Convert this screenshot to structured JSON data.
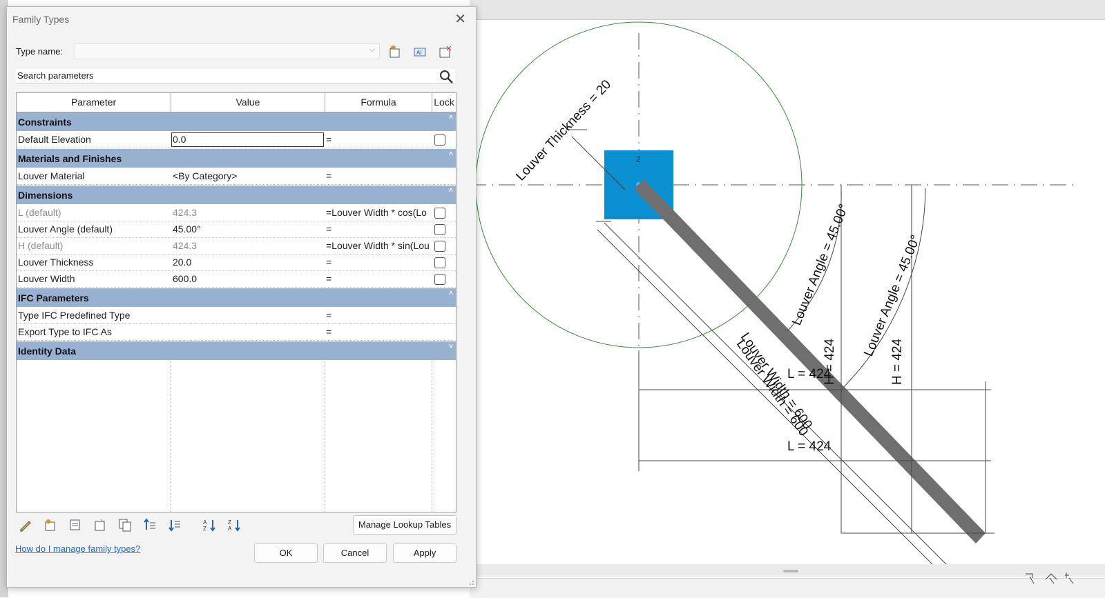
{
  "dialog": {
    "title": "Family Types",
    "type_name_label": "Type name:",
    "type_name_value": "",
    "search_placeholder": "Search parameters",
    "columns": {
      "parameter": "Parameter",
      "value": "Value",
      "formula": "Formula",
      "lock": "Lock"
    },
    "groups": {
      "constraints": "Constraints",
      "materials": "Materials and Finishes",
      "dimensions": "Dimensions",
      "ifc": "IFC Parameters",
      "identity": "Identity Data"
    },
    "rows": {
      "default_elevation": {
        "name": "Default Elevation",
        "value": "0.0",
        "formula": "="
      },
      "louver_material": {
        "name": "Louver Material",
        "value": "<By Category>",
        "formula": "="
      },
      "l_default": {
        "name": "L (default)",
        "value": "424.3",
        "formula": "=Louver Width * cos(Lo"
      },
      "louver_angle": {
        "name": "Louver Angle (default)",
        "value": "45.00°",
        "formula": "="
      },
      "h_default": {
        "name": "H (default)",
        "value": "424.3",
        "formula": "=Louver Width * sin(Lou"
      },
      "louver_thickness": {
        "name": "Louver Thickness",
        "value": "20.0",
        "formula": "="
      },
      "louver_width": {
        "name": "Louver Width",
        "value": "600.0",
        "formula": "="
      },
      "type_ifc": {
        "name": "Type IFC Predefined Type",
        "value": "",
        "formula": "="
      },
      "export_ifc": {
        "name": "Export Type to IFC As",
        "value": "",
        "formula": "="
      }
    },
    "buttons": {
      "manage_lookup": "Manage Lookup Tables",
      "help_link": "How do I manage family types?",
      "ok": "OK",
      "cancel": "Cancel",
      "apply": "Apply"
    }
  },
  "drawing": {
    "labels": {
      "louver_thickness": "Louver Thickness = 20",
      "louver_angle_1": "Louver Angle = 45.00°",
      "louver_angle_2": "Louver Angle = 45.00°",
      "louver_width_1": "Louver Width = 600",
      "louver_width_2": "Louver Width = 600",
      "l_upper": "L = 424",
      "l_lower": "L = 424",
      "h_1": "H = 424",
      "h_2": "H = 424",
      "marker": "2"
    },
    "colors": {
      "louver": "#6f6f6f",
      "selection": "#0a8fd0",
      "circle": "#3a8a3a"
    }
  }
}
